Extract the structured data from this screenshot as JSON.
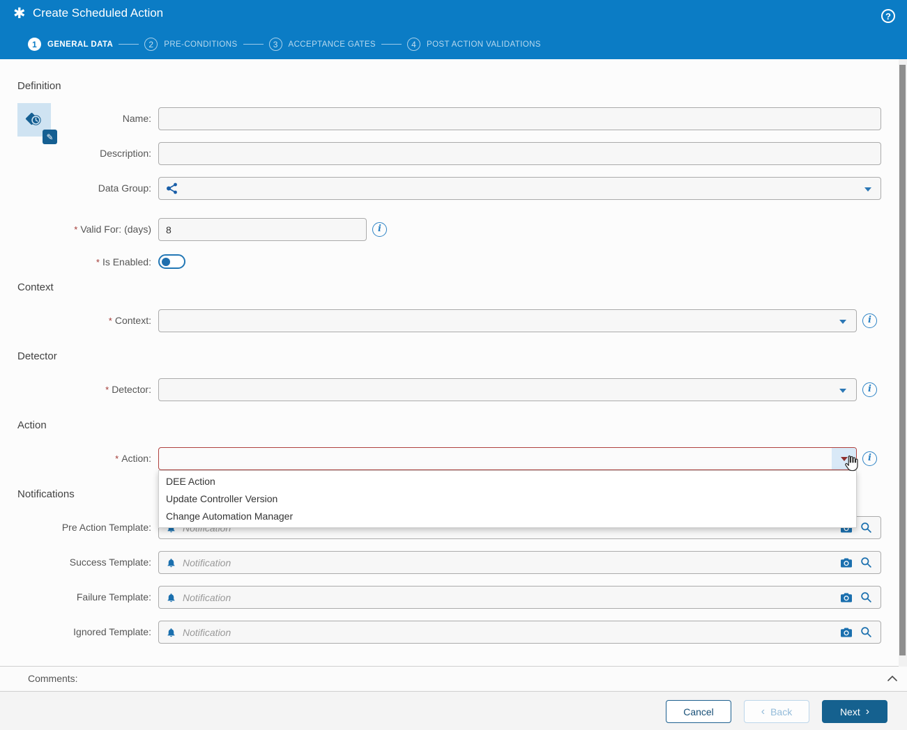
{
  "header": {
    "title": "Create Scheduled Action",
    "help_label": "?",
    "steps": [
      {
        "num": "1",
        "label": "GENERAL DATA"
      },
      {
        "num": "2",
        "label": "PRE-CONDITIONS"
      },
      {
        "num": "3",
        "label": "ACCEPTANCE GATES"
      },
      {
        "num": "4",
        "label": "POST ACTION VALIDATIONS"
      }
    ]
  },
  "ui": {
    "required_marker": "*",
    "back_chevron": "‹",
    "next_chevron": "›"
  },
  "definition": {
    "heading": "Definition",
    "name_label": "Name:",
    "description_label": "Description:",
    "data_group_label": "Data Group:",
    "valid_for_label": "Valid For: (days)",
    "valid_for_value": "8",
    "is_enabled_label": "Is Enabled:",
    "is_enabled_state": "off"
  },
  "context": {
    "heading": "Context",
    "label": "Context:"
  },
  "detector": {
    "heading": "Detector",
    "label": "Detector:"
  },
  "action": {
    "heading": "Action",
    "label": "Action:",
    "options": [
      "DEE Action",
      "Update Controller Version",
      "Change Automation Manager"
    ]
  },
  "notifications": {
    "heading": "Notifications",
    "placeholder": "Notification",
    "rows": [
      {
        "label": "Pre Action Template:"
      },
      {
        "label": "Success Template:"
      },
      {
        "label": "Failure Template:"
      },
      {
        "label": "Ignored Template:"
      }
    ]
  },
  "comments": {
    "label": "Comments:"
  },
  "footer": {
    "cancel": "Cancel",
    "back": "Back",
    "next": "Next"
  },
  "icons": {
    "title": "asterisk",
    "help": "question-circle",
    "edit": "pencil",
    "tile": "scheduled-action-clock",
    "data_group": "share",
    "dropdown": "caret-down",
    "info": "info-circle",
    "notification": "bell",
    "snapshot": "camera",
    "search": "magnifier",
    "collapse": "chevron-up"
  },
  "colors": {
    "header_blue": "#0b7cc5",
    "primary_dark": "#15618f",
    "icon_blue": "#1a6fae",
    "error_red": "#b0413e",
    "field_bg": "#f7f7f7"
  }
}
